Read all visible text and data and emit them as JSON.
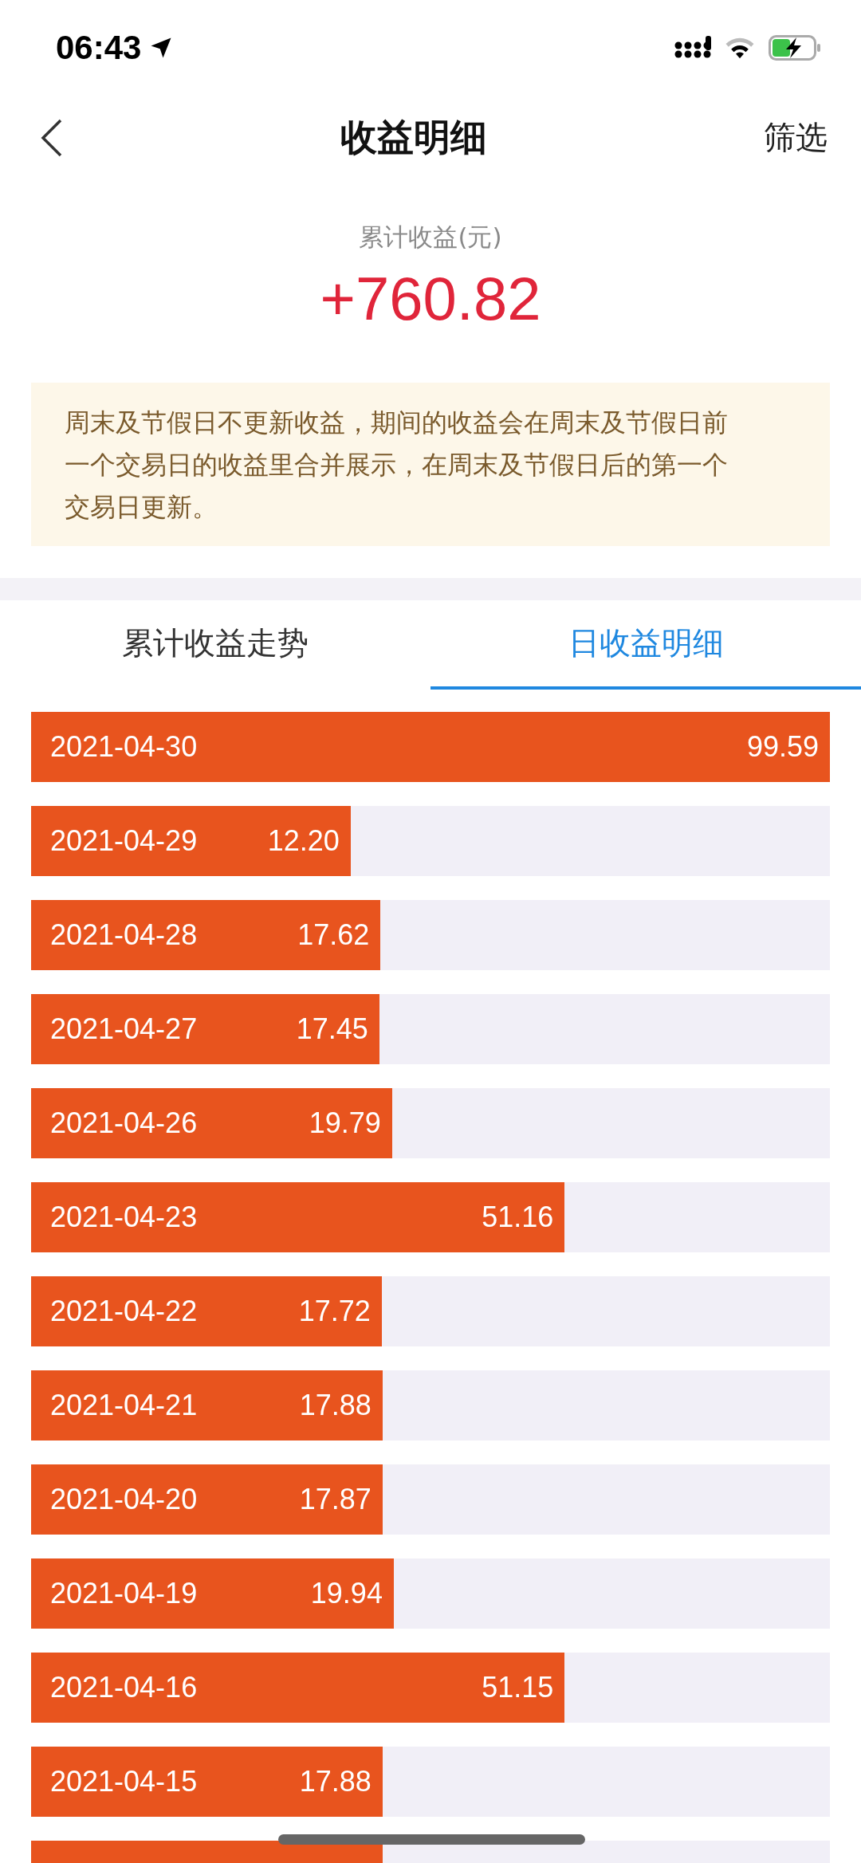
{
  "status_bar": {
    "time": "06:43"
  },
  "header": {
    "title": "收益明细",
    "action": "筛选"
  },
  "summary": {
    "label": "累计收益(元)",
    "amount": "+760.82"
  },
  "notice": "周末及节假日不更新收益，期间的收益会在周末及节假日前一个交易日的收益里合并展示，在周末及节假日后的第一个交易日更新。",
  "tabs": [
    {
      "label": "累计收益走势",
      "selected": false
    },
    {
      "label": "日收益明细",
      "selected": true
    }
  ],
  "rows": [
    {
      "date": "2021-04-30",
      "value": "99.59",
      "level": 1.0
    },
    {
      "date": "2021-04-29",
      "value": "12.20",
      "level": 0.4
    },
    {
      "date": "2021-04-28",
      "value": "17.62",
      "level": 0.4375
    },
    {
      "date": "2021-04-27",
      "value": "17.45",
      "level": 0.436
    },
    {
      "date": "2021-04-26",
      "value": "19.79",
      "level": 0.452
    },
    {
      "date": "2021-04-23",
      "value": "51.16",
      "level": 0.668
    },
    {
      "date": "2021-04-22",
      "value": "17.72",
      "level": 0.439
    },
    {
      "date": "2021-04-21",
      "value": "17.88",
      "level": 0.44
    },
    {
      "date": "2021-04-20",
      "value": "17.87",
      "level": 0.44
    },
    {
      "date": "2021-04-19",
      "value": "19.94",
      "level": 0.454
    },
    {
      "date": "2021-04-16",
      "value": "51.15",
      "level": 0.668
    },
    {
      "date": "2021-04-15",
      "value": "17.88",
      "level": 0.44
    },
    {
      "level": 0.44
    }
  ]
}
